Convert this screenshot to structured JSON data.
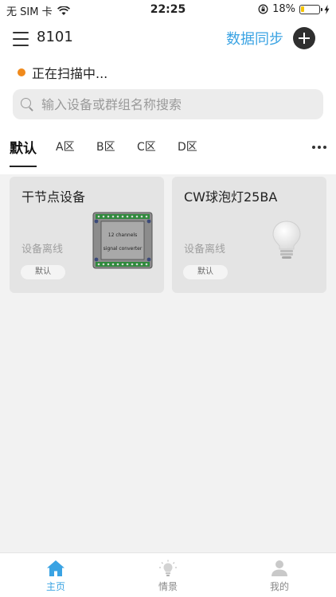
{
  "status_bar": {
    "carrier": "无 SIM 卡",
    "time": "22:25",
    "battery": "18%",
    "battery_level": 0.18
  },
  "header": {
    "home_id": "8101",
    "sync_label": "数据同步"
  },
  "scan_status": "正在扫描中...",
  "search": {
    "placeholder": "输入设备或群组名称搜索"
  },
  "tabs": [
    {
      "label": "默认",
      "active": true
    },
    {
      "label": "A区"
    },
    {
      "label": "B区"
    },
    {
      "label": "C区"
    },
    {
      "label": "D区"
    }
  ],
  "devices": [
    {
      "name": "干节点设备",
      "status": "设备离线",
      "group": "默认",
      "thumb_text": [
        "12 channels",
        "signal converter"
      ]
    },
    {
      "name": "CW球泡灯25BA",
      "status": "设备离线",
      "group": "默认"
    }
  ],
  "bottom_nav": [
    {
      "label": "主页",
      "icon": "home-icon",
      "active": true
    },
    {
      "label": "情景",
      "icon": "scene-bulb-icon"
    },
    {
      "label": "我的",
      "icon": "person-icon"
    }
  ],
  "colors": {
    "accent": "#3aa3e3",
    "scan_dot": "#f08a1c",
    "battery_fill": "#f5c400"
  }
}
